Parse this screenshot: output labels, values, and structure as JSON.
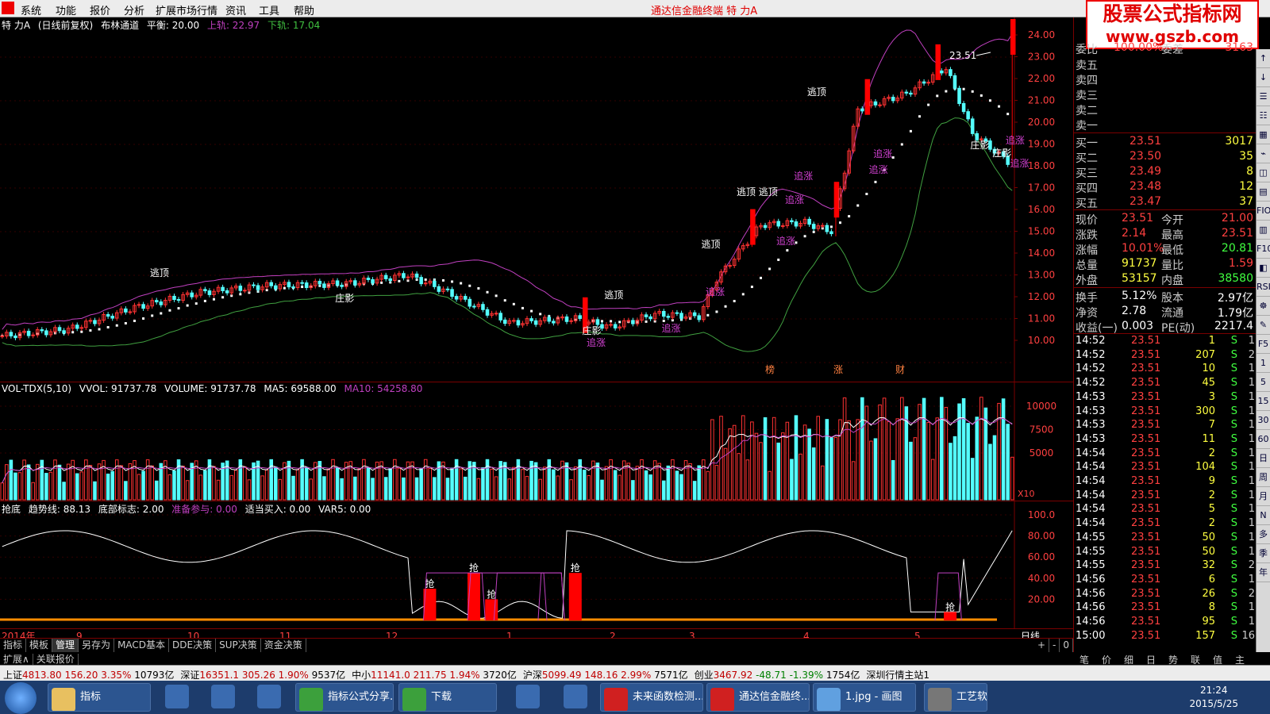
{
  "menu": {
    "items": [
      "系统",
      "功能",
      "报价",
      "分析",
      "扩展市场行情",
      "资讯",
      "工具",
      "帮助"
    ],
    "app_title": "通达信金融终端  特  力A"
  },
  "logo": {
    "line1": "股票公式指标网",
    "line2": "www.gszb.com"
  },
  "colors": {
    "up": "#ff3232",
    "down": "#54ffff",
    "mid": "#ffffff",
    "upper": "#c040c0",
    "lower": "#40a040",
    "grid": "#7a0000",
    "orange": "#ff8c00"
  },
  "main": {
    "name": "特 力A",
    "mode": "(日线前复权)",
    "indicator": "布林通道",
    "mid_label": "平衡: 20.00",
    "upper_label": "上轨: 22.97",
    "lower_label": "下轨: 17.04",
    "y_ticks": [
      "24.00",
      "23.00",
      "22.00",
      "21.00",
      "20.00",
      "19.00",
      "18.00",
      "17.00",
      "16.00",
      "15.00",
      "14.00",
      "13.00",
      "12.00",
      "11.00",
      "10.00"
    ],
    "price_annotation": "23.51",
    "signals_top": [
      "逃顶",
      "逃顶",
      "逃顶",
      "逃顶",
      "逃顶",
      "逃顶"
    ],
    "signals_mid": [
      "庄影",
      "庄影",
      "庄影",
      "庄影"
    ],
    "signals_bottom": [
      "追涨",
      "追涨",
      "追涨",
      "追涨",
      "追涨",
      "追涨",
      "追涨",
      "追涨",
      "追涨",
      "追涨"
    ],
    "event_labels": [
      "榜",
      "涨",
      "财"
    ]
  },
  "vol": {
    "name": "VOL-TDX(5,10)",
    "vvol": "VVOL: 91737.78",
    "volume": "VOLUME: 91737.78",
    "ma5": "MA5: 69588.00",
    "ma10": "MA10: 54258.80",
    "y_ticks": [
      "10000",
      "7500",
      "5000"
    ],
    "unit": "X10"
  },
  "ind": {
    "name": "抢底",
    "trend": "趋势线: 88.13",
    "bottom": "底部标志: 2.00",
    "prep": "准备参与: 0.00",
    "buy": "适当买入: 0.00",
    "var5": "VAR5: 0.00",
    "y_ticks": [
      "100.0",
      "80.00",
      "60.00",
      "40.00",
      "20.00"
    ],
    "signal_label": "抢"
  },
  "xaxis": {
    "labels": [
      "2014年",
      "9",
      "10",
      "11",
      "12",
      "1",
      "2",
      "3",
      "4",
      "5"
    ],
    "period": "日线"
  },
  "tabs": [
    "指标",
    "模板",
    "管理",
    "另存为",
    "MACD基本",
    "DDE决策",
    "SUP决策",
    "资金决策"
  ],
  "tabs2": [
    "扩展∧",
    "关联报价"
  ],
  "tab_buttons": [
    "+",
    "-",
    "0"
  ],
  "quote": {
    "weibi": "委比",
    "weibi_val": "100.00%",
    "weicha": "委差",
    "weicha_val": "3163",
    "sells": [
      "卖五",
      "卖四",
      "卖三",
      "卖二",
      "卖一"
    ],
    "buys": [
      {
        "label": "买一",
        "price": "23.51",
        "vol": "3017"
      },
      {
        "label": "买二",
        "price": "23.50",
        "vol": "35"
      },
      {
        "label": "买三",
        "price": "23.49",
        "vol": "8"
      },
      {
        "label": "买四",
        "price": "23.48",
        "vol": "12"
      },
      {
        "label": "买五",
        "price": "23.47",
        "vol": "37"
      }
    ],
    "stats": [
      {
        "l": "现价",
        "v": "23.51",
        "l2": "今开",
        "v2": "21.00"
      },
      {
        "l": "涨跌",
        "v": "2.14",
        "l2": "最高",
        "v2": "23.51"
      },
      {
        "l": "涨幅",
        "v": "10.01%",
        "l2": "最低",
        "v2": "20.81"
      },
      {
        "l": "总量",
        "v": "91737",
        "l2": "量比",
        "v2": "1.59"
      },
      {
        "l": "外盘",
        "v": "53157",
        "l2": "内盘",
        "v2": "38580"
      }
    ],
    "stats2": [
      {
        "l": "换手",
        "v": "5.12%",
        "l2": "股本",
        "v2": "2.97亿"
      },
      {
        "l": "净资",
        "v": "2.78",
        "l2": "流通",
        "v2": "1.79亿"
      },
      {
        "l": "收益(一)",
        "v": "0.003",
        "l2": "PE(动)",
        "v2": "2217.4"
      }
    ],
    "ticks": [
      [
        "14:52",
        "23.51",
        "1",
        "S",
        "1"
      ],
      [
        "14:52",
        "23.51",
        "207",
        "S",
        "2"
      ],
      [
        "14:52",
        "23.51",
        "10",
        "S",
        "1"
      ],
      [
        "14:52",
        "23.51",
        "45",
        "S",
        "1"
      ],
      [
        "14:53",
        "23.51",
        "3",
        "S",
        "1"
      ],
      [
        "14:53",
        "23.51",
        "300",
        "S",
        "1"
      ],
      [
        "14:53",
        "23.51",
        "7",
        "S",
        "1"
      ],
      [
        "14:53",
        "23.51",
        "11",
        "S",
        "1"
      ],
      [
        "14:54",
        "23.51",
        "2",
        "S",
        "1"
      ],
      [
        "14:54",
        "23.51",
        "104",
        "S",
        "1"
      ],
      [
        "14:54",
        "23.51",
        "9",
        "S",
        "1"
      ],
      [
        "14:54",
        "23.51",
        "2",
        "S",
        "1"
      ],
      [
        "14:54",
        "23.51",
        "5",
        "S",
        "1"
      ],
      [
        "14:54",
        "23.51",
        "2",
        "S",
        "1"
      ],
      [
        "14:55",
        "23.51",
        "50",
        "S",
        "1"
      ],
      [
        "14:55",
        "23.51",
        "50",
        "S",
        "1"
      ],
      [
        "14:55",
        "23.51",
        "32",
        "S",
        "2"
      ],
      [
        "14:56",
        "23.51",
        "6",
        "S",
        "1"
      ],
      [
        "14:56",
        "23.51",
        "26",
        "S",
        "2"
      ],
      [
        "14:56",
        "23.51",
        "8",
        "S",
        "1"
      ],
      [
        "14:56",
        "23.51",
        "95",
        "S",
        "1"
      ],
      [
        "15:00",
        "23.51",
        "157",
        "S",
        "16"
      ]
    ],
    "bottom_tabs": [
      "笔",
      "价",
      "细",
      "日",
      "势",
      "联",
      "值",
      "主"
    ]
  },
  "rightbar": [
    "↑",
    "↓",
    "☰",
    "☷",
    "▦",
    "⌁",
    "◫",
    "▤",
    "FIO",
    "▥",
    "F10",
    "◧",
    "RSI",
    "☸",
    "✎",
    "F5",
    "1",
    "5",
    "15",
    "30",
    "60",
    "日",
    "周",
    "月",
    "N",
    "多",
    "季",
    "年"
  ],
  "status": [
    {
      "name": "上证",
      "val": "4813.80",
      "chg": "156.20",
      "pct": "3.35%",
      "amt": "10793亿"
    },
    {
      "name": "深证",
      "val": "16351.1",
      "chg": "305.26",
      "pct": "1.90%",
      "amt": "9537亿"
    },
    {
      "name": "中小",
      "val": "11141.0",
      "chg": "211.75",
      "pct": "1.94%",
      "amt": "3720亿"
    },
    {
      "name": "沪深",
      "val": "5099.49",
      "chg": "148.16",
      "pct": "2.99%",
      "amt": "7571亿"
    },
    {
      "name": "创业",
      "val": "3467.92",
      "chg": "-48.71",
      "pct": "-1.39%",
      "amt": "1754亿"
    }
  ],
  "status_site": "深圳行情主站1",
  "taskbar": {
    "items": [
      "指标",
      "指标公式分享...",
      "下载",
      "未来函数检测...",
      "通达信金融终...",
      "1.jpg - 画图",
      "工艺软件"
    ],
    "time": "21:24",
    "date": "2015/5/25"
  }
}
